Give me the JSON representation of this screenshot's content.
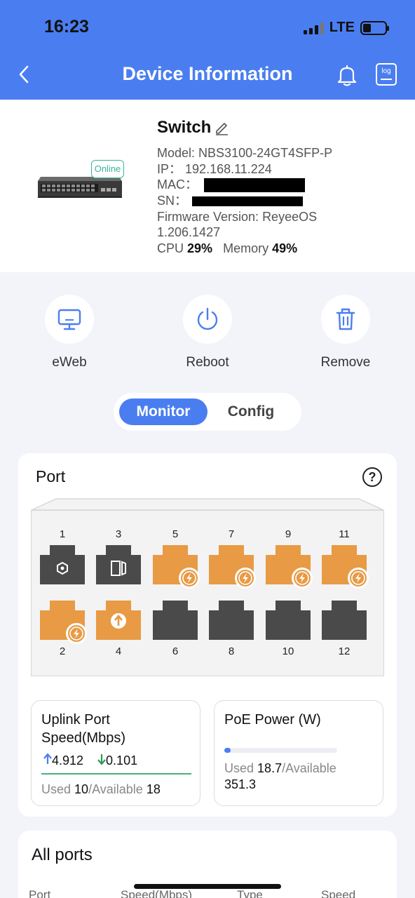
{
  "status_bar": {
    "time": "16:23",
    "network": "LTE"
  },
  "header": {
    "title": "Device Information",
    "log_label": "log",
    "back_icon": "chevron-left-icon",
    "bell_icon": "bell-icon"
  },
  "device": {
    "name": "Switch",
    "status": "Online",
    "model_label": "Model:",
    "model": "NBS3100-24GT4SFP-P",
    "ip_label": "IP：",
    "ip": "192.168.11.224",
    "mac_label": "MAC：",
    "sn_label": "SN：",
    "firmware_label": "Firmware Version:",
    "firmware": "ReyeeOS",
    "firmware_build": "1.206.1427",
    "cpu_label": "CPU",
    "cpu": "29%",
    "memory_label": "Memory",
    "memory": "49%"
  },
  "actions": [
    {
      "label": "eWeb",
      "icon": "monitor-icon"
    },
    {
      "label": "Reboot",
      "icon": "power-icon"
    },
    {
      "label": "Remove",
      "icon": "trash-icon"
    }
  ],
  "tabs": {
    "monitor": "Monitor",
    "config": "Config",
    "active": "Monitor"
  },
  "port_panel": {
    "title": "Port",
    "help": "?",
    "top_numbers": [
      "1",
      "3",
      "5",
      "7",
      "9",
      "11"
    ],
    "bottom_numbers": [
      "2",
      "4",
      "6",
      "8",
      "10",
      "12"
    ],
    "top_ports": [
      {
        "state": "dark",
        "icon": "hexagon-icon"
      },
      {
        "state": "dark",
        "icon": "sfp-icon"
      },
      {
        "state": "orange",
        "icon": "poe-icon"
      },
      {
        "state": "orange",
        "icon": "poe-icon"
      },
      {
        "state": "orange",
        "icon": "poe-icon"
      },
      {
        "state": "orange",
        "icon": "poe-icon"
      }
    ],
    "bottom_ports": [
      {
        "state": "orange",
        "icon": "poe-icon"
      },
      {
        "state": "orange",
        "icon": "uplink-icon"
      },
      {
        "state": "dark",
        "icon": ""
      },
      {
        "state": "dark",
        "icon": ""
      },
      {
        "state": "dark",
        "icon": ""
      },
      {
        "state": "dark",
        "icon": ""
      }
    ],
    "colors": {
      "orange": "#e89a44",
      "dark": "#4a4a4a",
      "accent": "#4a7ef0"
    }
  },
  "uplink": {
    "title_line1": "Uplink Port",
    "title_line2": "Speed(Mbps)",
    "up": "4.912",
    "down": "0.101",
    "used_label": "Used",
    "used": "10",
    "available_label": "/Available",
    "available": "18"
  },
  "poe": {
    "title": "PoE Power (W)",
    "used_label": "Used",
    "used": "18.7",
    "available_label": "/Available",
    "available": "351.3",
    "usage_fraction": 0.053
  },
  "all_ports": {
    "title": "All ports",
    "columns": [
      "Port",
      "Speed(Mbps)",
      "Type",
      "Speed"
    ]
  }
}
